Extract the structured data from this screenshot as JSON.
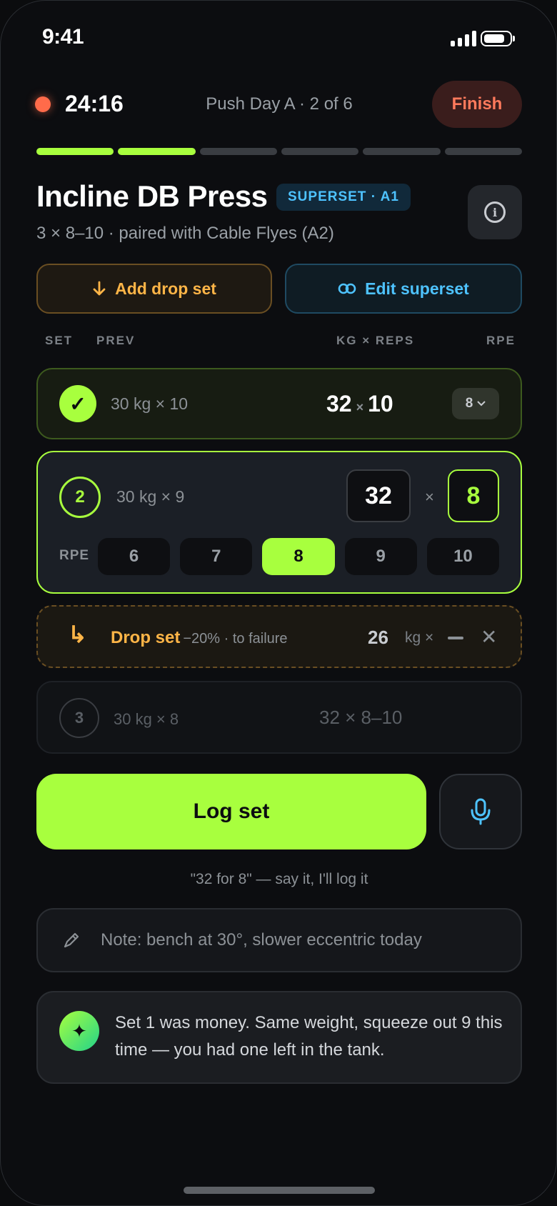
{
  "status_bar": {
    "time": "9:41"
  },
  "header": {
    "timer": "24:16",
    "workout": "Push Day A · 2 of 6",
    "finish_label": "Finish",
    "progress": {
      "total": 6,
      "completed": 2
    }
  },
  "exercise": {
    "title": "Incline DB Press",
    "badge": "SUPERSET · A1",
    "subtitle": "3 × 8–10 · paired with Cable Flyes (A2)",
    "add_drop_label": "Add drop set",
    "edit_superset_label": "Edit superset"
  },
  "columns": {
    "set": "SET",
    "prev": "PREV",
    "kg_reps": "KG × REPS",
    "rpe": "RPE"
  },
  "sets": {
    "s1": {
      "check": "✓",
      "prev": "30 kg × 10",
      "weight": "32",
      "times": "×",
      "reps": "10",
      "rpe": "8"
    },
    "s2": {
      "number": "2",
      "prev": "30 kg × 9",
      "weight": "32",
      "times": "×",
      "reps": "8",
      "rpe_label": "RPE",
      "rpe_options": [
        "6",
        "7",
        "8",
        "9",
        "10"
      ],
      "rpe_selected": "8"
    },
    "drop": {
      "arrow": "↳",
      "label": "Drop set",
      "sub": "−20% · to failure",
      "weight": "26",
      "unit": "kg ×",
      "remove": "✕"
    },
    "s3": {
      "number": "3",
      "prev": "30 kg × 8",
      "target": "32 × 8–10"
    }
  },
  "log": {
    "label": "Log set",
    "voice_hint": "\"32 for 8\" — say it, I'll log it"
  },
  "note": {
    "text": "Note: bench at 30°, slower eccentric today"
  },
  "coach": {
    "icon": "✦",
    "message": "Set 1 was money. Same weight, squeeze out 9 this time — you had one left in the tank."
  },
  "colors": {
    "accent": "#a8ff3e",
    "drop": "#ffb547",
    "superset": "#4ec3ff",
    "finish": "#ff7a5c"
  }
}
